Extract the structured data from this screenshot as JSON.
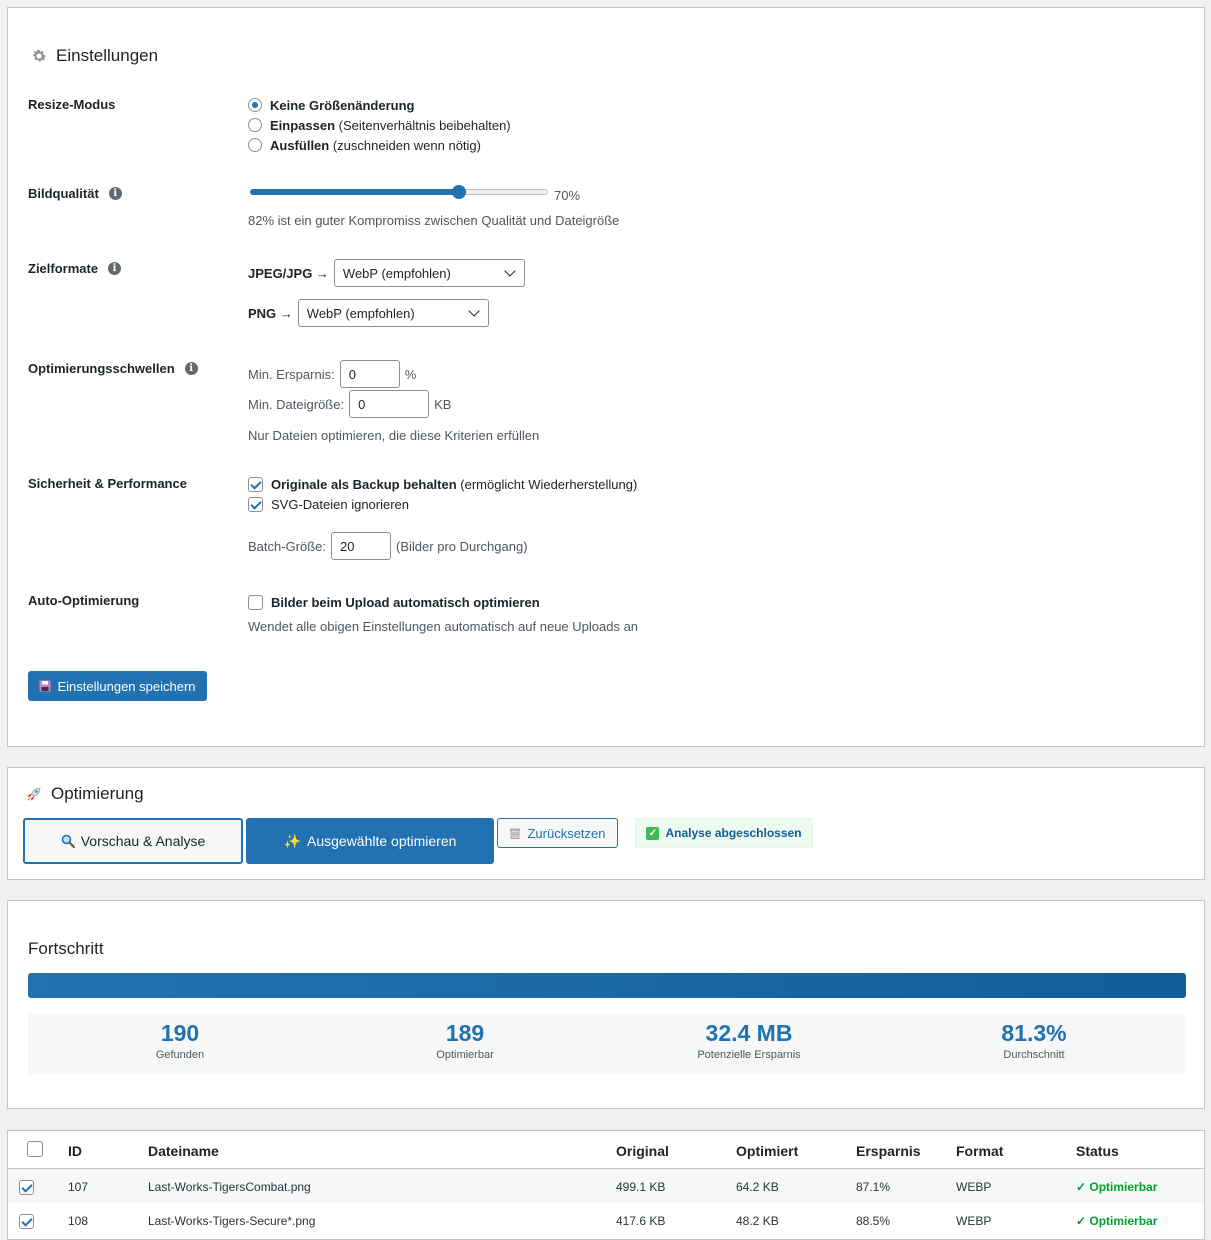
{
  "settings": {
    "title": "Einstellungen",
    "resize": {
      "label": "Resize-Modus",
      "options": [
        {
          "bold": "Keine Größenänderung",
          "rest": ""
        },
        {
          "bold": "Einpassen",
          "rest": " (Seitenverhältnis beibehalten)"
        },
        {
          "bold": "Ausfüllen",
          "rest": " (zuschneiden wenn nötig)"
        }
      ],
      "selected_index": 0
    },
    "quality": {
      "label": "Bildqualität",
      "value_text": "70%",
      "value": 70,
      "hint": "82% ist ein guter Kompromiss zwischen Qualität und Dateigröße"
    },
    "formats": {
      "label": "Zielformate",
      "jpeg_label": "JPEG/JPG →",
      "jpeg_value": "WebP (empfohlen)",
      "png_label": "PNG →",
      "png_value": "WebP (empfohlen)"
    },
    "thresholds": {
      "label": "Optimierungsschwellen",
      "min_savings_label": "Min. Ersparnis:",
      "min_savings_value": "0",
      "min_savings_unit": "%",
      "min_size_label": "Min. Dateigröße:",
      "min_size_value": "0",
      "min_size_unit": "KB",
      "hint": "Nur Dateien optimieren, die diese Kriterien erfüllen"
    },
    "safety": {
      "label": "Sicherheit & Performance",
      "backup_bold": "Originale als Backup behalten",
      "backup_rest": " (ermöglicht Wiederherstellung)",
      "backup_checked": true,
      "svg_label": "SVG-Dateien ignorieren",
      "svg_checked": true,
      "batch_label": "Batch-Größe:",
      "batch_value": "20",
      "batch_unit": "(Bilder pro Durchgang)"
    },
    "auto": {
      "label": "Auto-Optimierung",
      "checkbox_label": "Bilder beim Upload automatisch optimieren",
      "checked": false,
      "hint": "Wendet alle obigen Einstellungen automatisch auf neue Uploads an"
    },
    "save_label": "Einstellungen speichern"
  },
  "optimization": {
    "title": "Optimierung",
    "preview_label": "Vorschau & Analyse",
    "optimize_label": "Ausgewählte optimieren",
    "reset_label": "Zurücksetzen",
    "status_label": "Analyse abgeschlossen"
  },
  "progress": {
    "title": "Fortschritt",
    "percent": 100,
    "stats": [
      {
        "value": "190",
        "label": "Gefunden"
      },
      {
        "value": "189",
        "label": "Optimierbar"
      },
      {
        "value": "32.4 MB",
        "label": "Potenzielle Ersparnis"
      },
      {
        "value": "81.3%",
        "label": "Durchschnitt"
      }
    ]
  },
  "table": {
    "headers": [
      "ID",
      "Dateiname",
      "Original",
      "Optimiert",
      "Ersparnis",
      "Format",
      "Status"
    ],
    "rows": [
      {
        "checked": true,
        "id": "107",
        "name": "Last-Works-TigersCombat.png",
        "original": "499.1 KB",
        "optimized": "64.2 KB",
        "savings": "87.1%",
        "format": "WEBP",
        "status": "✓ Optimierbar"
      },
      {
        "checked": true,
        "id": "108",
        "name": "Last-Works-Tigers-Secure*.png",
        "original": "417.6 KB",
        "optimized": "48.2 KB",
        "savings": "88.5%",
        "format": "WEBP",
        "status": "✓ Optimierbar"
      }
    ]
  },
  "colors": {
    "accent": "#2271b1",
    "success": "#00a32a"
  }
}
